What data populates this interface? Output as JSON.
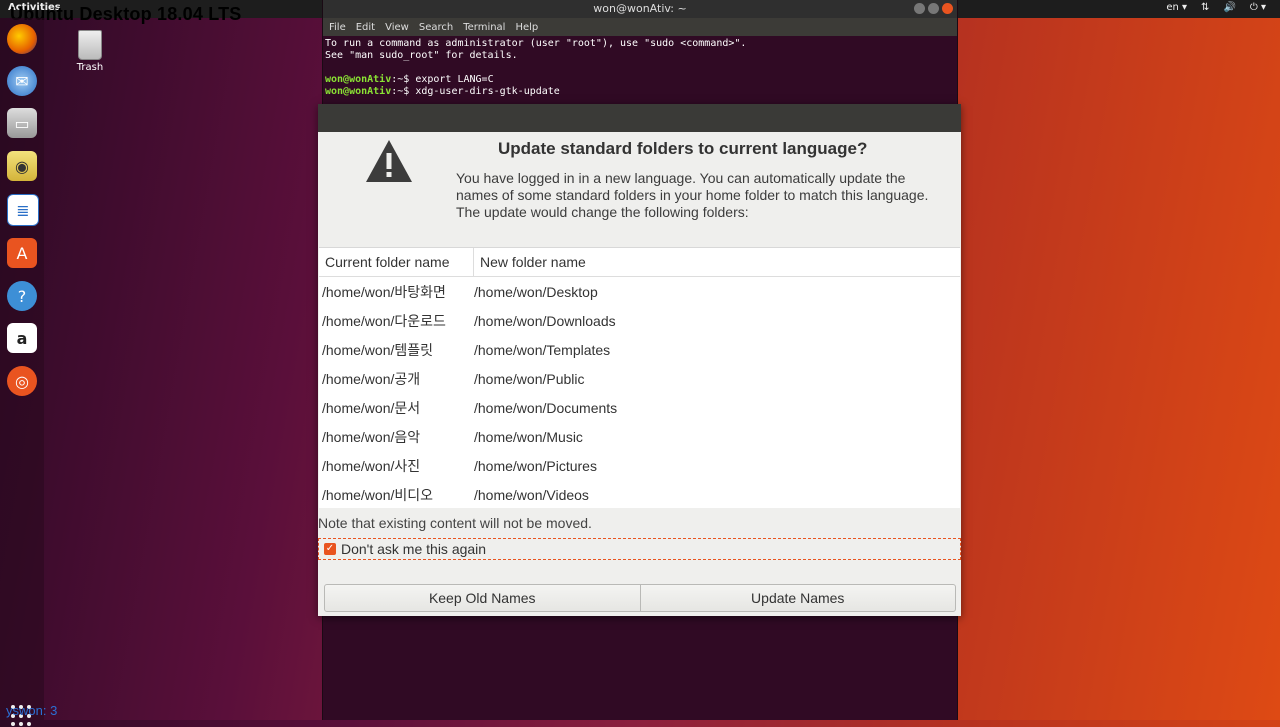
{
  "overlay": {
    "title": "Ubuntu Desktop 18.04 LTS",
    "bottom_text": "yswon:   3"
  },
  "topbar": {
    "activities": "Activities",
    "lang": "en ▾"
  },
  "desktop": {
    "trash_label": "Trash"
  },
  "dock": {
    "items": [
      "firefox-icon",
      "thunderbird-icon",
      "files-icon",
      "rhythmbox-icon",
      "libreoffice-writer-icon",
      "software-center-icon",
      "help-icon",
      "amazon-icon",
      "ubuntu-icon"
    ]
  },
  "terminal": {
    "title": "won@wonAtiv: ~",
    "menu": [
      "File",
      "Edit",
      "View",
      "Search",
      "Terminal",
      "Help"
    ],
    "line1": "To run a command as administrator (user \"root\"), use \"sudo <command>\".",
    "line2": "See \"man sudo_root\" for details.",
    "prompt": "won@wonAtiv",
    "prompt_suffix": ":~$ ",
    "cmd1": "export LANG=C",
    "cmd2": "xdg-user-dirs-gtk-update"
  },
  "dialog": {
    "title": "Update standard folders to current language?",
    "message": "You have logged in in a new language. You can automatically update the names of some standard folders in your home folder to match this language. The update would change the following folders:",
    "col_current": "Current folder name",
    "col_new": "New folder name",
    "rows": [
      {
        "current": "/home/won/바탕화면",
        "new": "/home/won/Desktop"
      },
      {
        "current": "/home/won/다운로드",
        "new": "/home/won/Downloads"
      },
      {
        "current": "/home/won/템플릿",
        "new": "/home/won/Templates"
      },
      {
        "current": "/home/won/공개",
        "new": "/home/won/Public"
      },
      {
        "current": "/home/won/문서",
        "new": "/home/won/Documents"
      },
      {
        "current": "/home/won/음악",
        "new": "/home/won/Music"
      },
      {
        "current": "/home/won/사진",
        "new": "/home/won/Pictures"
      },
      {
        "current": "/home/won/비디오",
        "new": "/home/won/Videos"
      }
    ],
    "note": "Note that existing content will not be moved.",
    "checkbox_label": "Don't ask me this again",
    "checkbox_checked": true,
    "keep_button": "Keep Old Names",
    "update_button": "Update Names"
  },
  "colors": {
    "accent": "#e95420",
    "terminal_bg": "#300a24",
    "prompt": "#8ae234"
  }
}
